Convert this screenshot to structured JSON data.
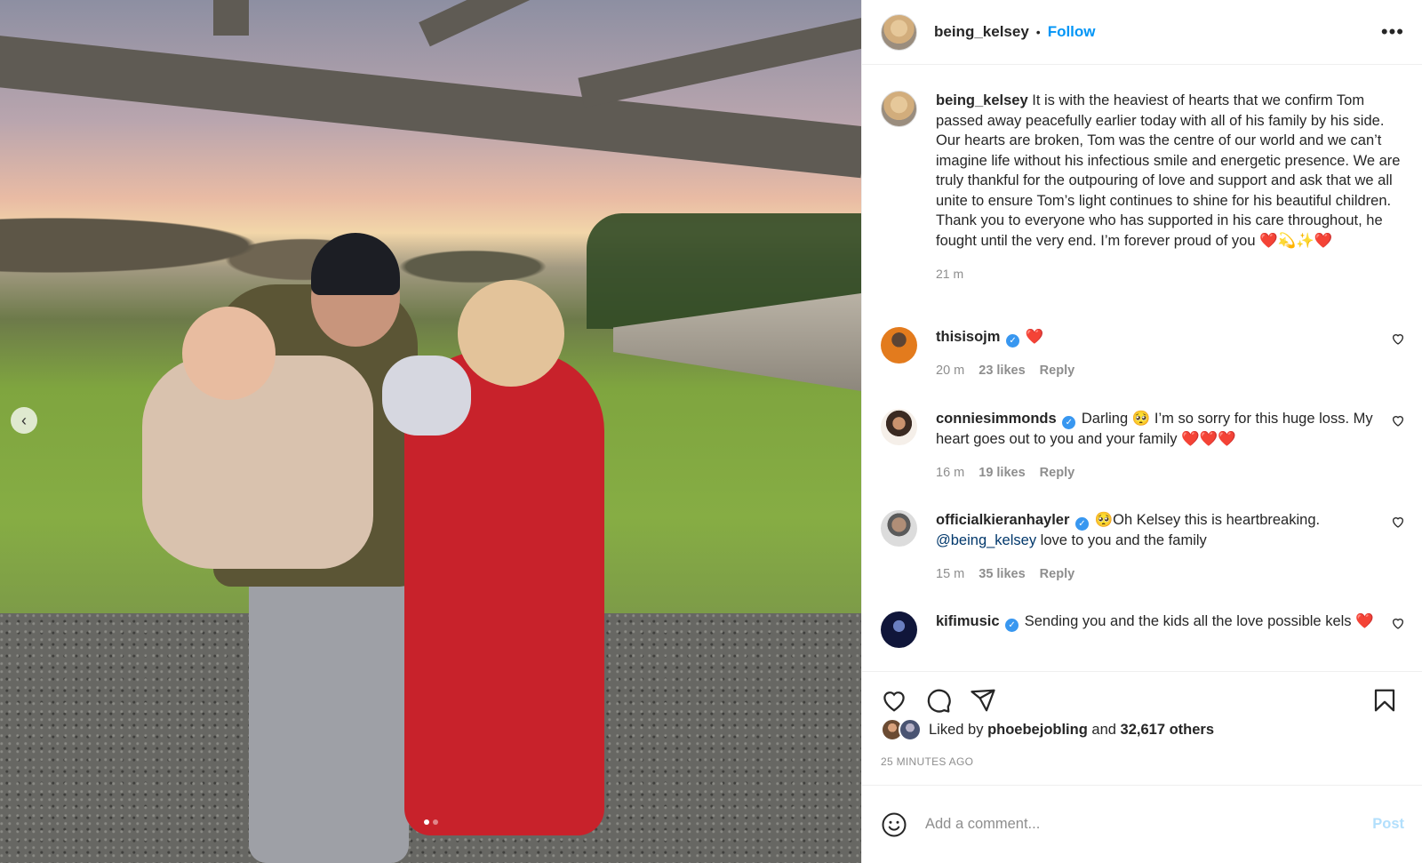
{
  "post": {
    "username": "being_kelsey",
    "follow_label": "Follow",
    "more_label": "•••",
    "caption": "It is with the heaviest of hearts that we confirm Tom passed away peacefully earlier today with all of his family by his side. Our hearts are broken, Tom was the centre of our world and we can’t imagine life without his infectious smile and energetic presence. We are truly thankful for the outpouring of love and support and ask that we all unite to ensure Tom’s light continues to shine for his beautiful children. Thank you to everyone who has supported in his care throughout, he fought until the very end. I’m forever proud of you ",
    "caption_emoji": "❤️💫✨❤️",
    "caption_time": "21 m",
    "liked_by_prefix": "Liked by",
    "liked_by_user": "phoebejobling",
    "liked_by_and": "and",
    "liked_by_others": "32,617 others",
    "posted_ago": "25 MINUTES AGO"
  },
  "comments": [
    {
      "username": "thisisojm",
      "verified": true,
      "text": "",
      "emoji": "❤️",
      "time": "20 m",
      "likes": "23 likes",
      "reply": "Reply"
    },
    {
      "username": "conniesimmonds",
      "verified": true,
      "text": "Darling 🥺 I’m so sorry for this huge loss. My heart goes out to you and your family ",
      "emoji": "❤️❤️❤️",
      "time": "16 m",
      "likes": "19 likes",
      "reply": "Reply"
    },
    {
      "username": "officialkieranhayler",
      "verified": true,
      "text_prefix": "🥺Oh Kelsey this is heartbreaking. ",
      "mention": "@being_kelsey",
      "text_suffix": " love to you and the family",
      "time": "15 m",
      "likes": "35 likes",
      "reply": "Reply"
    },
    {
      "username": "kifimusic",
      "verified": true,
      "text": "Sending you and the kids all the love possible kels ",
      "emoji": "❤️"
    }
  ],
  "add_comment": {
    "placeholder": "Add a comment...",
    "post_label": "Post"
  },
  "icons": {
    "like": "heart-icon",
    "comment": "comment-icon",
    "share": "share-icon",
    "save": "bookmark-icon",
    "emoji": "smiley-icon",
    "prev": "chevron-left-icon"
  },
  "carousel": {
    "slides": 2,
    "active": 1
  },
  "colors": {
    "link_blue": "#0095f6",
    "muted": "#8e8e8e",
    "verified": "#3897f0",
    "post_disabled": "#b2dffc"
  }
}
